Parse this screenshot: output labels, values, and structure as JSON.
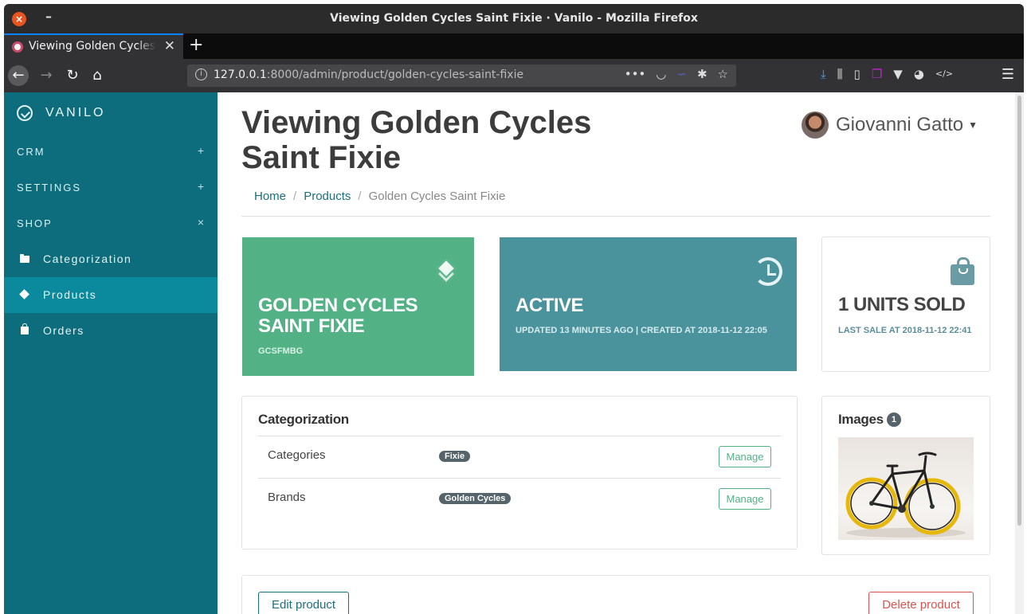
{
  "window": {
    "title": "Viewing Golden Cycles Saint Fixie · Vanilo - Mozilla Firefox"
  },
  "browser": {
    "tab_label": "Viewing Golden Cycles Saint Fixie",
    "url_host": "127.0.0.1",
    "url_rest": ":8000/admin/product/golden-cycles-saint-fixie"
  },
  "sidebar": {
    "brand": "VANILO",
    "groups": [
      {
        "label": "CRM",
        "toggle": "+"
      },
      {
        "label": "SETTINGS",
        "toggle": "+"
      },
      {
        "label": "SHOP",
        "toggle": "×"
      }
    ],
    "items": [
      {
        "label": "Categorization",
        "icon": "folder-icon"
      },
      {
        "label": "Products",
        "icon": "layers-icon",
        "active": true
      },
      {
        "label": "Orders",
        "icon": "shopping-bag-icon"
      }
    ]
  },
  "header": {
    "title": "Viewing Golden Cycles Saint Fixie",
    "user_name": "Giovanni Gatto"
  },
  "breadcrumb": {
    "home": "Home",
    "products": "Products",
    "current": "Golden Cycles Saint Fixie"
  },
  "cards": {
    "product": {
      "title": "GOLDEN CYCLES SAINT FIXIE",
      "sub": "GCSFMBG"
    },
    "status": {
      "title": "ACTIVE",
      "sub": "UPDATED 13 MINUTES AGO | CREATED AT 2018-11-12 22:05"
    },
    "sales": {
      "title": "1 UNITS SOLD",
      "sub": "LAST SALE AT 2018-11-12 22:41"
    }
  },
  "categorization": {
    "title": "Categorization",
    "rows": [
      {
        "label": "Categories",
        "badge": "Fixie",
        "button": "Manage"
      },
      {
        "label": "Brands",
        "badge": "Golden Cycles",
        "button": "Manage"
      }
    ]
  },
  "images": {
    "title": "Images",
    "count": "1"
  },
  "actions": {
    "edit": "Edit product",
    "delete": "Delete product"
  },
  "colors": {
    "sidebar": "#0d6d7c",
    "sidebar_active": "#0b8a9e",
    "green_card": "#52b286",
    "teal_card": "#4a929c",
    "danger": "#d9534f"
  }
}
